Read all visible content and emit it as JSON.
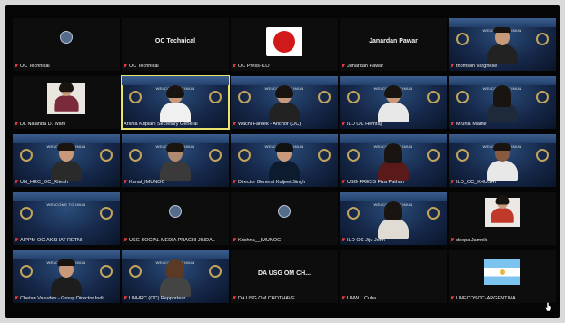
{
  "tiles": [
    {
      "label": "OC Technical",
      "header": ""
    },
    {
      "label": "OC Technical",
      "header": "OC Technical"
    },
    {
      "label": "OC Press-ILO",
      "header": ""
    },
    {
      "label": "Janardan Pawar",
      "header": "Janardan Pawar"
    },
    {
      "label": "thomson varghese",
      "header": ""
    },
    {
      "label": "Dr. Nalanda D. Wani",
      "header": ""
    },
    {
      "label": "Arshia Kripiani Secretary General",
      "header": ""
    },
    {
      "label": "Wachi Fareek - Anchor (OC)",
      "header": ""
    },
    {
      "label": "ILO OC Hemraj",
      "header": ""
    },
    {
      "label": "Mrunal Mame",
      "header": ""
    },
    {
      "label": "UN_HRC_OC_Ritesh",
      "header": ""
    },
    {
      "label": "Kunal_IMUNOC",
      "header": ""
    },
    {
      "label": "Director General Kuljeet Singh",
      "header": ""
    },
    {
      "label": "USG PRESS Fiza Pathan",
      "header": ""
    },
    {
      "label": "ILO_OC_KHUSHI",
      "header": ""
    },
    {
      "label": "AIPPM-OC-AKSHAT RETNI",
      "header": ""
    },
    {
      "label": "USG SOCIAL MEDIA PRACHI JINDAL",
      "header": ""
    },
    {
      "label": "Krishna__IMUNOC",
      "header": ""
    },
    {
      "label": "ILO OC Jiju John",
      "header": ""
    },
    {
      "label": "deepa Jamnik",
      "header": ""
    },
    {
      "label": "Chetan Vasudev - Group Director Indi...",
      "header": ""
    },
    {
      "label": "UNHRC (OC) Rapporteur",
      "header": ""
    },
    {
      "label": "DA USG OM CHOTHAVE",
      "header": "DA USG OM CH..."
    },
    {
      "label": "UNW J Cuba",
      "header": ""
    },
    {
      "label": "UNECOSOC-ARGENTINA",
      "header": ""
    }
  ],
  "banner_text": "WELCOME TO IMUN",
  "colors": {
    "active_border": "#e8e36a",
    "muted_mic": "#e03a3a"
  }
}
